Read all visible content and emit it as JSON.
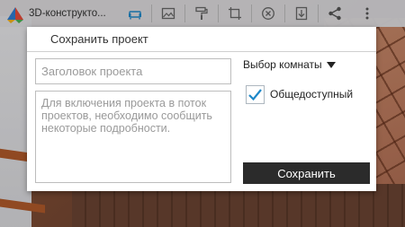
{
  "app": {
    "title": "3D-конструкто..."
  },
  "toolbar": {
    "icons": [
      "sofa-icon",
      "image-icon",
      "paint-roller-icon",
      "crop-icon",
      "close-circle-icon",
      "download-icon",
      "share-icon",
      "more-vertical-icon"
    ]
  },
  "dialog": {
    "title": "Сохранить проект",
    "title_placeholder": "Заголовок проекта",
    "description_placeholder": "Для включения проекта в поток проектов, необходимо сообщить некоторые подробности.",
    "room_select_label": "Выбор комнаты",
    "public_label": "Общедоступный",
    "public_checked": true,
    "save_label": "Сохранить"
  },
  "colors": {
    "accent": "#1e88c8",
    "save_button": "#2b2b2b"
  }
}
